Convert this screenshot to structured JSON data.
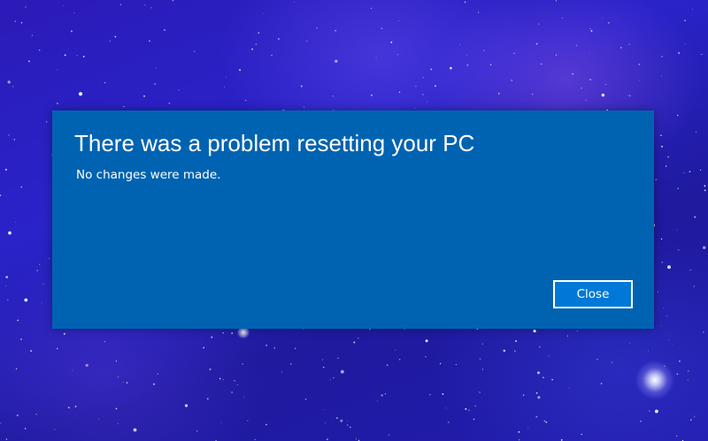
{
  "dialog": {
    "title": "There was a problem resetting your PC",
    "message": "No changes were made.",
    "close_label": "Close"
  },
  "colors": {
    "dialog_background": "#0063b1",
    "button_background": "#0078d7",
    "text": "#ffffff",
    "wallpaper_base": "#2a23c9"
  }
}
